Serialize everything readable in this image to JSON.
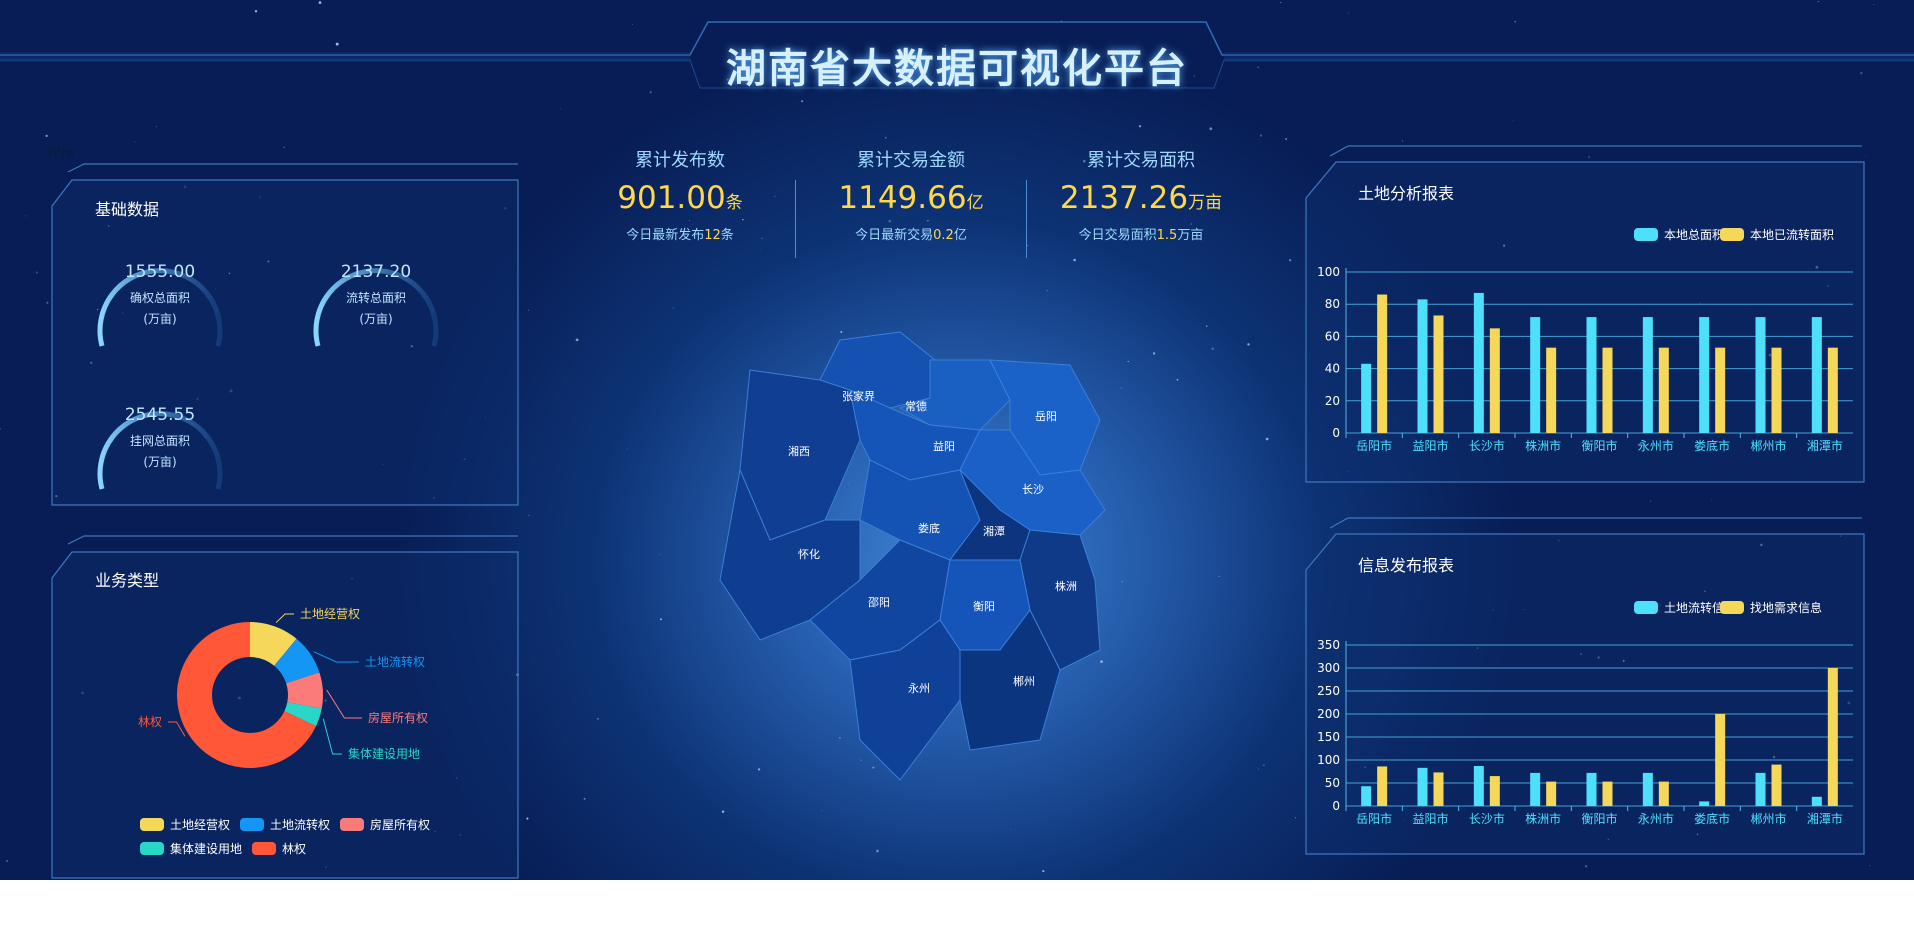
{
  "title": "湖南省大数据可视化平台",
  "stray_text": "h're",
  "colors": {
    "cyan": "#4ee0fb",
    "yellow": "#f5d75a",
    "blue": "#1496f4",
    "salmon": "#fb7b7b",
    "teal": "#2ad6c7",
    "red": "#ff5737"
  },
  "basic": {
    "title": "基础数据",
    "items": [
      {
        "value": "1555.00",
        "label1": "确权总面积",
        "label2": "(万亩)"
      },
      {
        "value": "2137.20",
        "label1": "流转总面积",
        "label2": "(万亩)"
      },
      {
        "value": "2545.55",
        "label1": "挂网总面积",
        "label2": "(万亩)"
      }
    ]
  },
  "business": {
    "title": "业务类型"
  },
  "stats": [
    {
      "title": "累计发布数",
      "value": "901.00",
      "unit": "条",
      "desc_prefix": "今日最新发布",
      "desc_value": "12",
      "desc_unit": "条"
    },
    {
      "title": "累计交易金额",
      "value": "1149.66",
      "unit": "亿",
      "desc_prefix": "今日最新交易",
      "desc_value": "0.2",
      "desc_unit": "亿"
    },
    {
      "title": "累计交易面积",
      "value": "2137.26",
      "unit": "万亩",
      "desc_prefix": "今日交易面积",
      "desc_value": "1.5",
      "desc_unit": "万亩"
    }
  ],
  "map": {
    "labels": [
      "张家界",
      "常德",
      "岳阳",
      "湘西",
      "益阳",
      "长沙",
      "娄底",
      "湘潭",
      "怀化",
      "株洲",
      "邵阳",
      "衡阳",
      "永州",
      "郴州"
    ]
  },
  "chart_data": [
    {
      "type": "bar",
      "title": "土地分析报表",
      "categories": [
        "岳阳市",
        "益阳市",
        "长沙市",
        "株洲市",
        "衡阳市",
        "永州市",
        "娄底市",
        "郴州市",
        "湘潭市"
      ],
      "series": [
        {
          "name": "本地总面积",
          "color": "#4ee0fb",
          "values": [
            43,
            83,
            87,
            72,
            72,
            72,
            72,
            72,
            72
          ]
        },
        {
          "name": "本地已流转面积",
          "color": "#f5d75a",
          "values": [
            86,
            73,
            65,
            53,
            53,
            53,
            53,
            53,
            53
          ]
        }
      ],
      "ylim": [
        0,
        100
      ],
      "yticks": [
        0,
        20,
        40,
        60,
        80,
        100
      ],
      "grid": true,
      "legend": "top-right"
    },
    {
      "type": "bar",
      "title": "信息发布报表",
      "categories": [
        "岳阳市",
        "益阳市",
        "长沙市",
        "株洲市",
        "衡阳市",
        "永州市",
        "娄底市",
        "郴州市",
        "湘潭市"
      ],
      "series": [
        {
          "name": "土地流转信息",
          "color": "#4ee0fb",
          "values": [
            43,
            83,
            87,
            72,
            72,
            72,
            10,
            72,
            20
          ]
        },
        {
          "name": "找地需求信息",
          "color": "#f5d75a",
          "values": [
            86,
            73,
            65,
            53,
            53,
            53,
            200,
            90,
            300
          ]
        }
      ],
      "ylim": [
        0,
        350
      ],
      "yticks": [
        0,
        50,
        100,
        150,
        200,
        250,
        300,
        350
      ],
      "grid": true,
      "legend": "top-right"
    },
    {
      "type": "pie",
      "title": "",
      "slices": [
        {
          "name": "土地经营权",
          "value": 11,
          "color": "#f5d75a"
        },
        {
          "name": "土地流转权",
          "value": 9,
          "color": "#1496f4"
        },
        {
          "name": "房屋所有权",
          "value": 8,
          "color": "#fb7b7b"
        },
        {
          "name": "集体建设用地",
          "value": 4,
          "color": "#2ad6c7"
        },
        {
          "name": "林权",
          "value": 68,
          "color": "#ff5737"
        }
      ],
      "legend": "bottom"
    }
  ]
}
